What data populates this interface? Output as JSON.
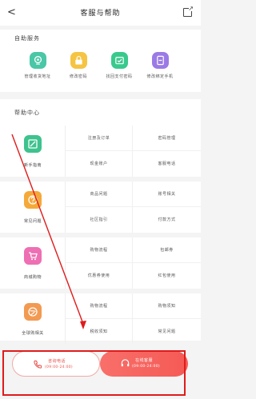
{
  "nav": {
    "back_glyph": "<",
    "title": "客服与帮助",
    "ext_icon": "external-link-icon"
  },
  "self_service": {
    "title": "自助服务",
    "items": [
      {
        "label": "管理收货地址",
        "icon": "address-pin-icon",
        "color": "#49c7a6"
      },
      {
        "label": "修改密码",
        "icon": "lock-icon",
        "color": "#f5c443"
      },
      {
        "label": "找回支付密码",
        "icon": "wallet-check-icon",
        "color": "#39c98c"
      },
      {
        "label": "修改绑定手机",
        "icon": "phone-link-icon",
        "color": "#9b7ae6"
      }
    ]
  },
  "help_center": {
    "title": "帮助中心",
    "rows": [
      {
        "label": "新手指南",
        "icon": "guide-book-icon",
        "color": "#3ec28e",
        "cells": [
          "注册及订单",
          "密码管理",
          "现金账户",
          "客服电话"
        ]
      },
      {
        "label": "常见问题",
        "icon": "question-icon",
        "color": "#f5a93a",
        "cells": [
          "商品问题",
          "账号相关",
          "社区指引",
          "付款方式"
        ]
      },
      {
        "label": "商城购物",
        "icon": "cart-icon",
        "color": "#ee6fb3",
        "cells": [
          "购物流程",
          "包邮券",
          "优惠券使用",
          "红包使用"
        ]
      },
      {
        "label": "全球购相关",
        "icon": "globe-icon",
        "color": "#f29a52",
        "cells": [
          "购物流程",
          "购物须知",
          "税收须知",
          "常见问题"
        ]
      }
    ]
  },
  "bottom": {
    "phone": {
      "title": "咨询电话",
      "hours": "(09:00-24:00)",
      "icon": "phone-icon"
    },
    "service": {
      "title": "在线客服",
      "hours": "(09:00-24:00)",
      "icon": "headset-icon"
    }
  },
  "annotation": {
    "color": "#e01b1b"
  }
}
